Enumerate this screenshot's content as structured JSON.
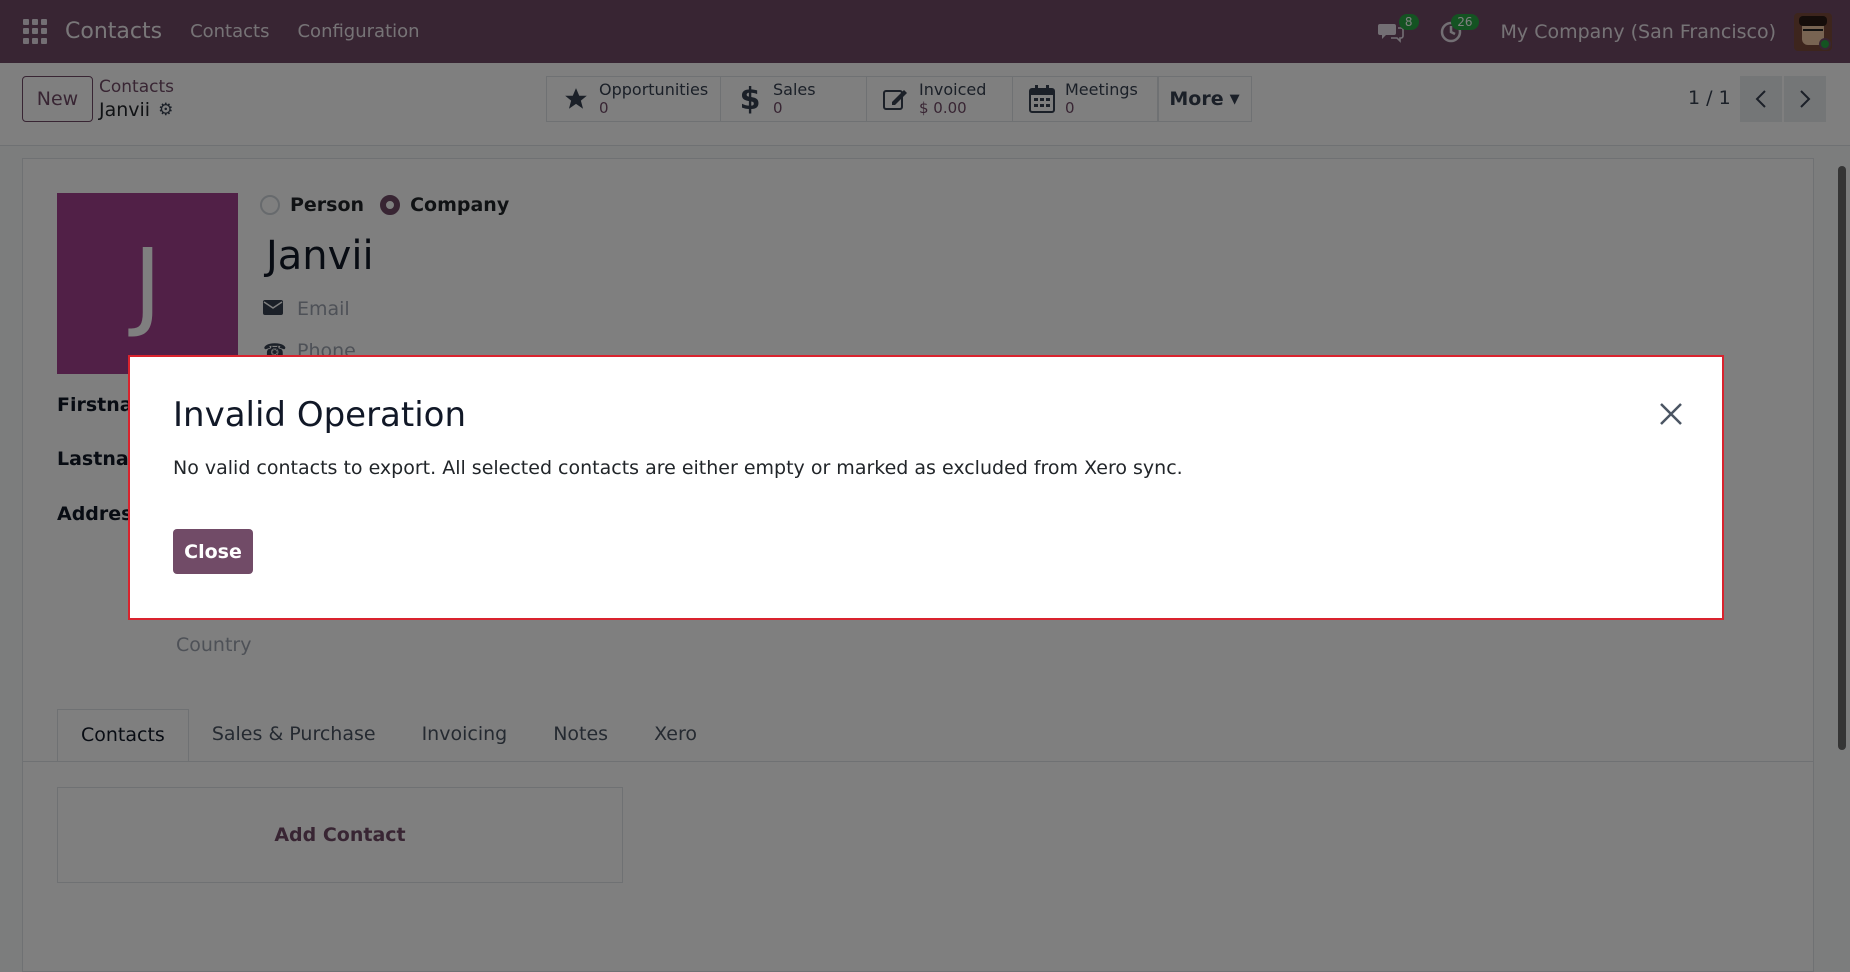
{
  "navbar": {
    "app_name": "Contacts",
    "menu": [
      "Contacts",
      "Configuration"
    ],
    "messages_count": "8",
    "activities_count": "26",
    "company": "My Company (San Francisco)"
  },
  "control": {
    "new_label": "New",
    "breadcrumb_parent": "Contacts",
    "breadcrumb_current": "Janvii",
    "smart_buttons": [
      {
        "label": "Opportunities",
        "value": "0",
        "icon": "star-icon"
      },
      {
        "label": "Sales",
        "value": "0",
        "icon": "dollar-icon"
      },
      {
        "label": "Invoiced",
        "value": "$ 0.00",
        "icon": "edit-icon"
      },
      {
        "label": "Meetings",
        "value": "0",
        "icon": "calendar-icon"
      }
    ],
    "more_label": "More",
    "pager": "1 / 1"
  },
  "form": {
    "avatar_letter": "J",
    "type_person": "Person",
    "type_company": "Company",
    "selected_type": "Company",
    "name": "Janvii",
    "email_placeholder": "Email",
    "phone_placeholder": "Phone",
    "labels": {
      "firstname": "Firstnar",
      "lastname": "Lastnam",
      "address": "Address"
    },
    "country_placeholder": "Country",
    "tabs": [
      "Contacts",
      "Sales & Purchase",
      "Invoicing",
      "Notes",
      "Xero"
    ],
    "active_tab": "Contacts",
    "add_contact": "Add Contact"
  },
  "dialog": {
    "title": "Invalid Operation",
    "message": "No valid contacts to export. All selected contacts are either empty or marked as excluded from Xero sync.",
    "close_label": "Close"
  },
  "colors": {
    "brand": "#714b67",
    "dialog_border": "#d9232e",
    "badge": "#28a745"
  }
}
